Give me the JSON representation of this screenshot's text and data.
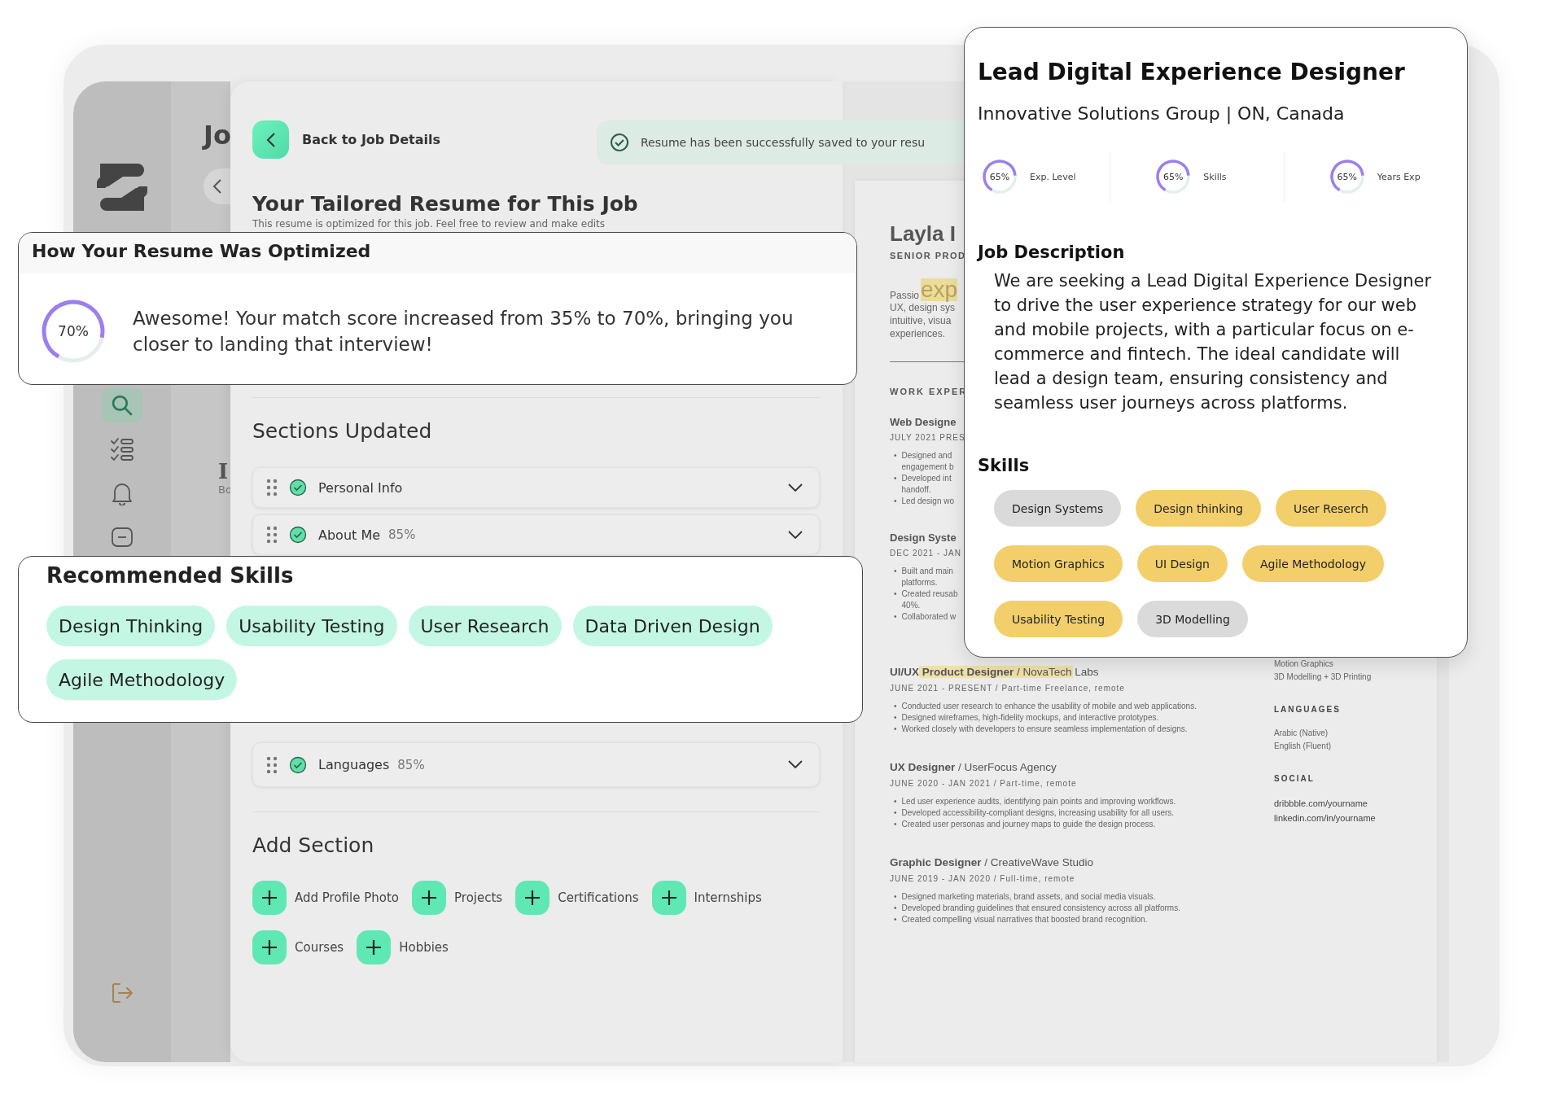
{
  "sidebar": {
    "items": [
      {
        "kind": "search",
        "selected": true
      },
      {
        "kind": "checklist",
        "selected": false
      },
      {
        "kind": "bell",
        "selected": false
      },
      {
        "kind": "message",
        "selected": false
      }
    ]
  },
  "background": {
    "heading": "Jo",
    "row_initial": "I",
    "row_subtext": "Bo"
  },
  "back_button": {
    "label": "Back to Job Details"
  },
  "toast": {
    "text": "Resume has been successfully saved to your resu"
  },
  "title": "Your Tailored Resume for This Job",
  "subtitle": "This resume is optimized for this job. Feel free to review and make edits",
  "optimized_card": {
    "title": "How Your Resume Was Optimized",
    "score": {
      "label": "70%",
      "level": 0.7
    },
    "message": "Awesome! Your match score increased from 35% to 70%, bringing you closer to landing that interview!"
  },
  "sections_updated": {
    "title": "Sections Updated",
    "items": [
      {
        "label": "Personal Info",
        "done": true
      },
      {
        "label": "About Me",
        "score": "85%",
        "done": true
      },
      {
        "label": "Languages",
        "score": "85%",
        "done": true
      }
    ]
  },
  "recommended_skills": {
    "title": "Recommended Skills",
    "items": [
      "Design Thinking",
      "Usability Testing",
      "User Research",
      "Data Driven Design",
      "Agile Methodology"
    ]
  },
  "add_section": {
    "title": "Add Section",
    "items": [
      "Add Profile Photo",
      "Projects",
      "Certifications",
      "Internships",
      "Courses",
      "Hobbies"
    ]
  },
  "resume": {
    "bullet_marker": "•",
    "name": "Layla I",
    "headline": "SENIOR PROD",
    "summary_lead": "Passio",
    "summary_highlight": "exp",
    "summary_lines": [
      "UX, design sys",
      "intuitive, visua",
      "experiences."
    ],
    "work_heading": "WORK EXPER",
    "clipped_jobs": [
      {
        "title": "Web Designe",
        "dates": "JULY 2021 PRES",
        "bullets": [
          {
            "lines": [
              "Designed and",
              "engagement b"
            ]
          },
          {
            "lines": [
              "Developed int",
              "handoff."
            ]
          },
          {
            "lines": [
              "Led design wo"
            ]
          }
        ]
      },
      {
        "title": "Design Syste",
        "dates": "DEC 2021 - JAN",
        "bullets": [
          {
            "lines": [
              "Built and main",
              "platforms."
            ]
          },
          {
            "lines": [
              "Created reusab",
              "40%."
            ]
          },
          {
            "lines": [
              "Collaborated w"
            ]
          }
        ]
      }
    ],
    "jobs": [
      {
        "heading": "**UI/UX Product Designer** / NovaTech Labs",
        "highlighted": true,
        "dates": "JUNE 2021 - PRESENT / Part-time Freelance, remote",
        "bullets": [
          "Conducted user research to enhance the usability of mobile and web applications.",
          "Designed wireframes, high-fidelity mockups, and interactive prototypes.",
          "Worked closely with developers to ensure seamless implementation of designs."
        ]
      },
      {
        "heading": "**UX Designer** / UserFocus Agency",
        "highlighted": false,
        "dates": "JUNE 2020 - JAN 2021 / Part-time, remote",
        "bullets": [
          "Led user experience audits, identifying pain points and improving workflows.",
          "Developed accessibility-compliant designs, increasing usability for all users.",
          "Created user personas and journey maps to guide the design process."
        ]
      },
      {
        "heading": "**Graphic Designer** / CreativeWave Studio",
        "highlighted": false,
        "dates": "JUNE 2019 - JAN 2020 / Full-time, remote",
        "bullets": [
          "Designed marketing materials, brand assets, and social media visuals.",
          "Developed branding guidelines that ensured consistency across all platforms.",
          "Created compelling visual narratives that boosted brand recognition."
        ]
      }
    ],
    "skills_tail": [
      "Motion Graphics",
      "3D Modelling + 3D Printing"
    ],
    "languages": {
      "title": "LANGUAGES",
      "items": [
        "Arabic (Native)",
        "English (Fluent)"
      ]
    },
    "social": {
      "title": "SOCIAL",
      "items": [
        "dribbble.com/yourname",
        "linkedin.com/in/yourname"
      ]
    }
  },
  "job_card": {
    "title": "Lead Digital Experience Designer",
    "company": "Innovative Solutions Group | ON, Canada",
    "metrics": [
      {
        "value": "65%",
        "label": "Exp. Level",
        "level": 0.65
      },
      {
        "value": "65%",
        "label": "Skills",
        "level": 0.65
      },
      {
        "value": "65%",
        "label": "Years Exp",
        "level": 0.65
      }
    ],
    "description_title": "Job Description",
    "description": "We are seeking a Lead Digital Experience Designer to drive the user experience strategy for our web and mobile projects, with a particular focus on e-commerce and fintech. The ideal candidate will lead a design team, ensuring consistency and seamless user journeys across platforms.",
    "skills_title": "Skills",
    "skills": [
      {
        "label": "Design Systems",
        "matched": false
      },
      {
        "label": "Design thinking",
        "matched": true
      },
      {
        "label": "User Reserch",
        "matched": true
      },
      {
        "label": "Motion Graphics",
        "matched": true
      },
      {
        "label": "UI Design",
        "matched": true
      },
      {
        "label": "Agile Methodology",
        "matched": true
      },
      {
        "label": "Usability Testing",
        "matched": true
      },
      {
        "label": "3D Modelling",
        "matched": false
      }
    ]
  }
}
